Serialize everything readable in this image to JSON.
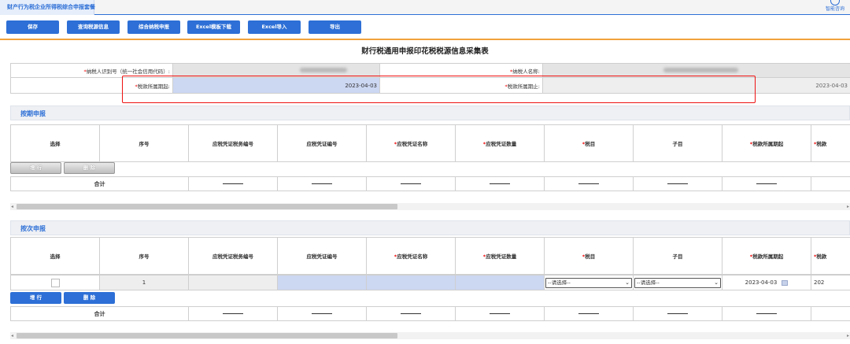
{
  "tab": {
    "label": "财产行为税企业所得税综合申报套餐"
  },
  "helper": {
    "label": "智能咨询"
  },
  "toolbar": {
    "save": "保存",
    "query_source": "查询税源信息",
    "comprehensive": "综合纳税申报",
    "excel_template": "Excel模板下载",
    "excel_import": "Excel导入",
    "export": "导出"
  },
  "page_title": "财行税通用申报印花税税源信息采集表",
  "form": {
    "taxpayer_id_label": "纳税人识别号（统一社会信用代码）:",
    "taxpayer_name_label": "纳税人名称:",
    "period_start_label": "税款所属期起:",
    "period_start_value": "2023-04-03",
    "period_end_label": "税款所属期止:",
    "period_end_value": "2023-04-03"
  },
  "section1": {
    "title": "按期申报"
  },
  "section2": {
    "title": "按次申报"
  },
  "columns": [
    "选择",
    "序号",
    "应税凭证税务编号",
    "应税凭证编号",
    "应税凭证名称",
    "应税凭证数量",
    "税目",
    "子目",
    "税款所属期起",
    "税款"
  ],
  "required_cols": [
    4,
    5,
    6,
    8,
    9
  ],
  "buttons": {
    "add": "增 行",
    "delete": "删 除"
  },
  "summary_label": "合计",
  "row": {
    "index": "1",
    "tax_item_select": "--请选择--",
    "sub_item_select": "--请选择--",
    "period_start": "2023-04-03",
    "period_partial": "202"
  },
  "colors": {
    "accent": "#2d6fd6",
    "highlight_box": "#e11111",
    "required_star": "#e00000",
    "divider": "#f0a23b"
  }
}
